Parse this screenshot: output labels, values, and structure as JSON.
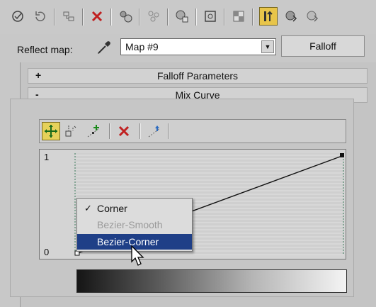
{
  "toolbar": {
    "icons": [
      "camera-icon",
      "undo-icon",
      "link-icon",
      "delete-icon",
      "material-icon",
      "particle-icon",
      "background-icon",
      "sample-icon",
      "checker-icon",
      "show-in-viewport-icon",
      "go-parent-icon",
      "go-forward-icon"
    ]
  },
  "reflect": {
    "label": "Reflect map:",
    "map_value": "Map #9",
    "falloff_label": "Falloff"
  },
  "rollouts": {
    "falloff_sign": "+",
    "falloff_title": "Falloff Parameters",
    "mix_sign": "-",
    "mix_title": "Mix Curve"
  },
  "curve_toolbar": {
    "icons": [
      "move-icon",
      "scale-point-icon",
      "add-point-icon",
      "delete-point-icon",
      "reset-curve-icon"
    ]
  },
  "graph": {
    "y_max_label": "1",
    "y_min_label": "0"
  },
  "context_menu": {
    "items": [
      {
        "label": "Corner",
        "checked": true,
        "state": "normal"
      },
      {
        "label": "Bezier-Smooth",
        "checked": false,
        "state": "disabled"
      },
      {
        "label": "Bezier-Corner",
        "checked": false,
        "state": "selected"
      }
    ],
    "check_glyph": "✓"
  },
  "colors": {
    "accent": "#e8c54a",
    "menu_selected": "#1f3f87"
  }
}
